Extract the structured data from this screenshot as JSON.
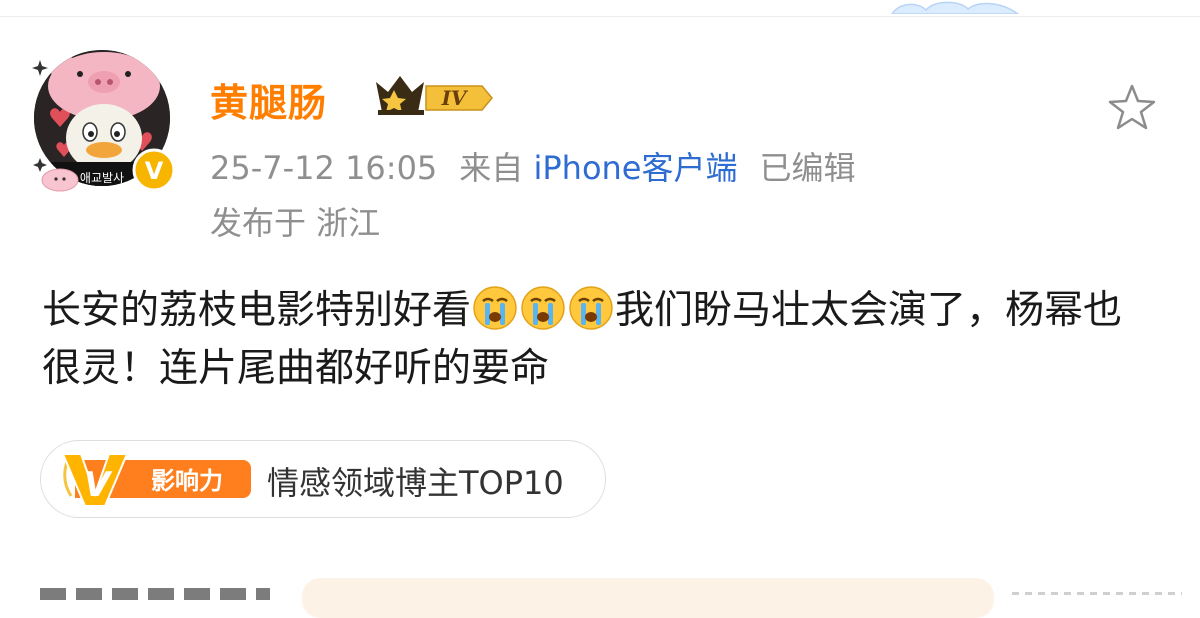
{
  "post": {
    "author": "黄腿肠",
    "level": "IV",
    "time": "25-7-12 16:05",
    "source_prefix": "来自",
    "source": "iPhone客户端",
    "edited": "已编辑",
    "location": "发布于 浙江",
    "text_part1": "长安的荔枝电影特别好看",
    "text_part2": "我们盼马壮太会演了，杨幂也很灵！连片尾曲都好听的要命",
    "emoji_names": [
      "crying-face-icon",
      "crying-face-icon",
      "crying-face-icon"
    ]
  },
  "tag": {
    "badge_letter": "V",
    "badge_label": "影响力",
    "text": "情感领域博主TOP10"
  },
  "avatar": {
    "caption": "애교발사"
  },
  "colors": {
    "username": "#ff7e00",
    "link": "#2f6cd1",
    "meta": "#8f8f8f",
    "badge_orange": "#ff7f1e"
  }
}
